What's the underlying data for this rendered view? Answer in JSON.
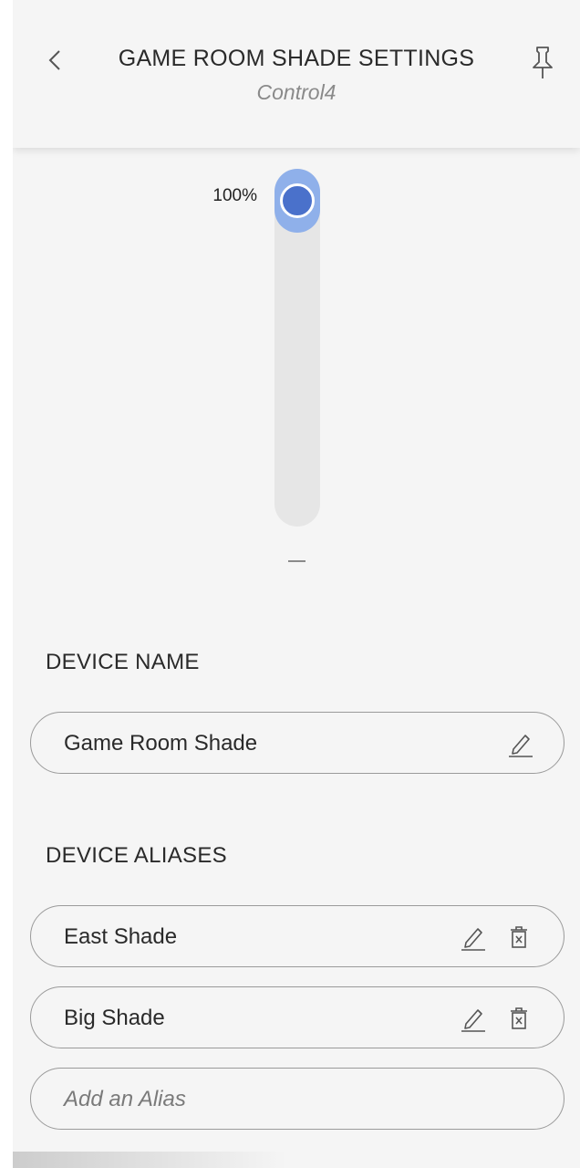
{
  "header": {
    "title": "GAME ROOM SHADE SETTINGS",
    "subtitle": "Control4",
    "back_icon": "chevron-left-icon",
    "pin_icon": "pin-icon"
  },
  "slider": {
    "value_label": "100%",
    "level": 1.0,
    "accent_color": "#4a71cb",
    "fill_color": "#8fb0ea"
  },
  "device_name": {
    "heading": "DEVICE NAME",
    "value": "Game Room Shade",
    "edit_icon": "pencil-icon"
  },
  "device_aliases": {
    "heading": "DEVICE ALIASES",
    "items": [
      {
        "label": "East Shade"
      },
      {
        "label": "Big Shade"
      }
    ],
    "add_placeholder": "Add an Alias",
    "edit_icon": "pencil-icon",
    "delete_icon": "trash-icon"
  }
}
